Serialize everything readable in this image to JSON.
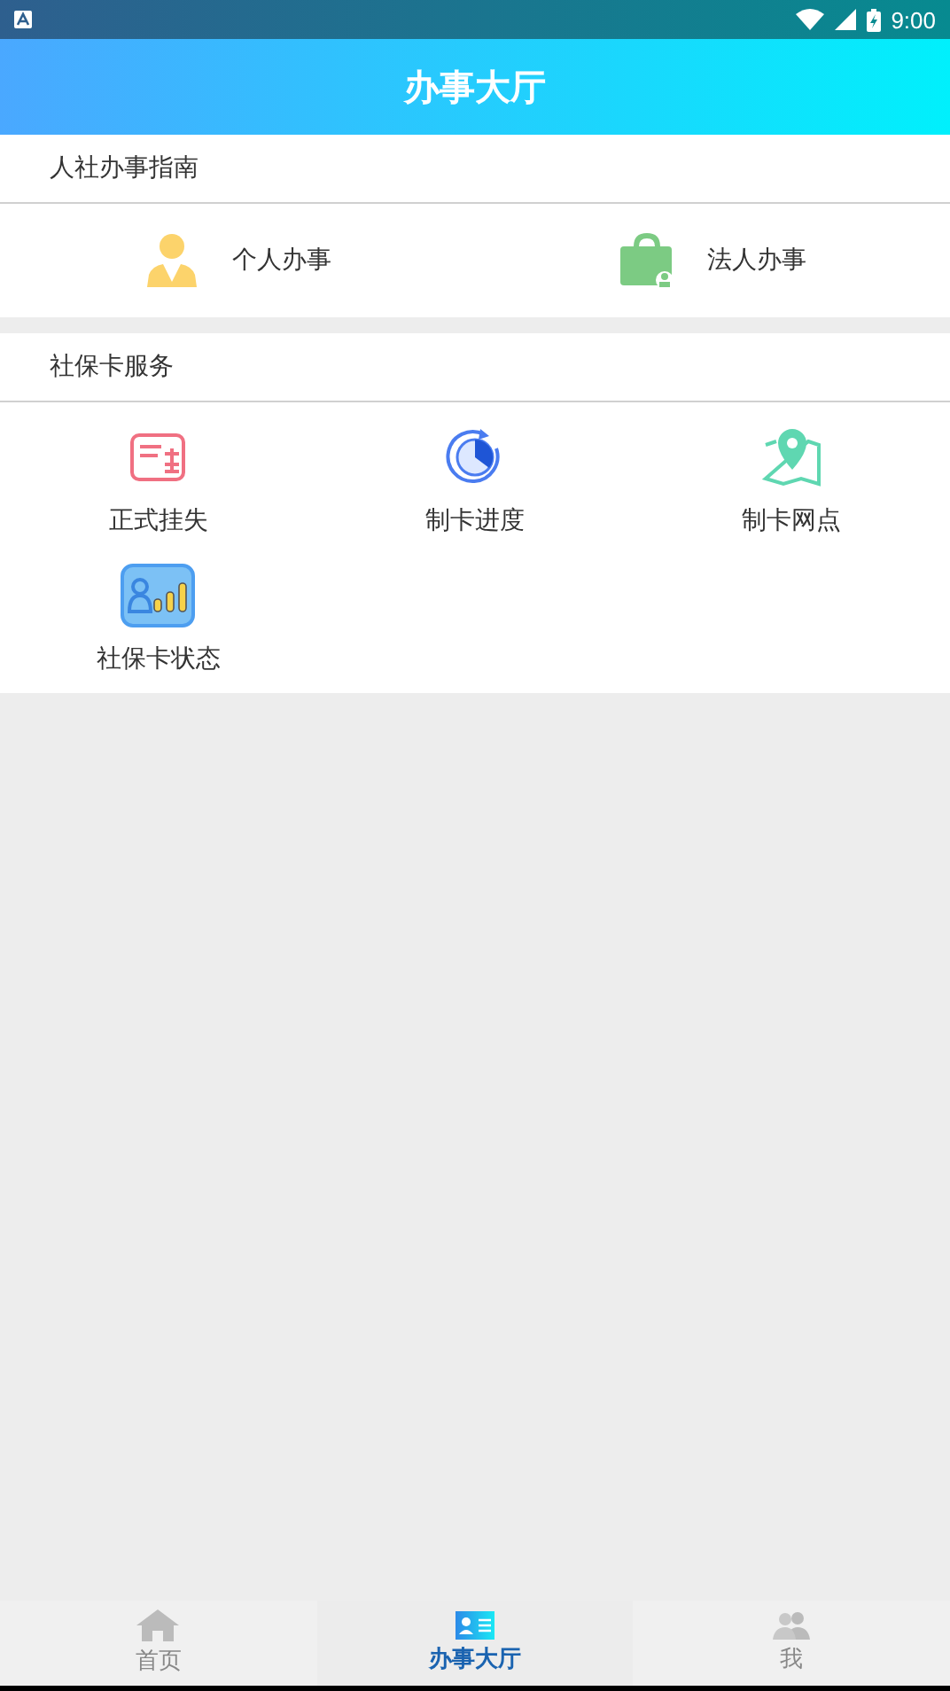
{
  "status_bar": {
    "time": "9:00"
  },
  "header": {
    "title": "办事大厅"
  },
  "sections": [
    {
      "title": "人社办事指南",
      "kind": "row",
      "items": [
        {
          "label": "个人办事",
          "kind": "person"
        },
        {
          "label": "法人办事",
          "kind": "briefcase"
        }
      ]
    },
    {
      "title": "社保卡服务",
      "kind": "grid",
      "items": [
        {
          "label": "正式挂失",
          "kind": "card"
        },
        {
          "label": "制卡进度",
          "kind": "progress"
        },
        {
          "label": "制卡网点",
          "kind": "map"
        },
        {
          "label": "社保卡状态",
          "kind": "status"
        }
      ]
    }
  ],
  "tabs": [
    {
      "label": "首页",
      "kind": "home",
      "selected": false
    },
    {
      "label": "办事大厅",
      "kind": "idcard",
      "selected": true
    },
    {
      "label": "我",
      "kind": "people",
      "selected": false
    }
  ]
}
